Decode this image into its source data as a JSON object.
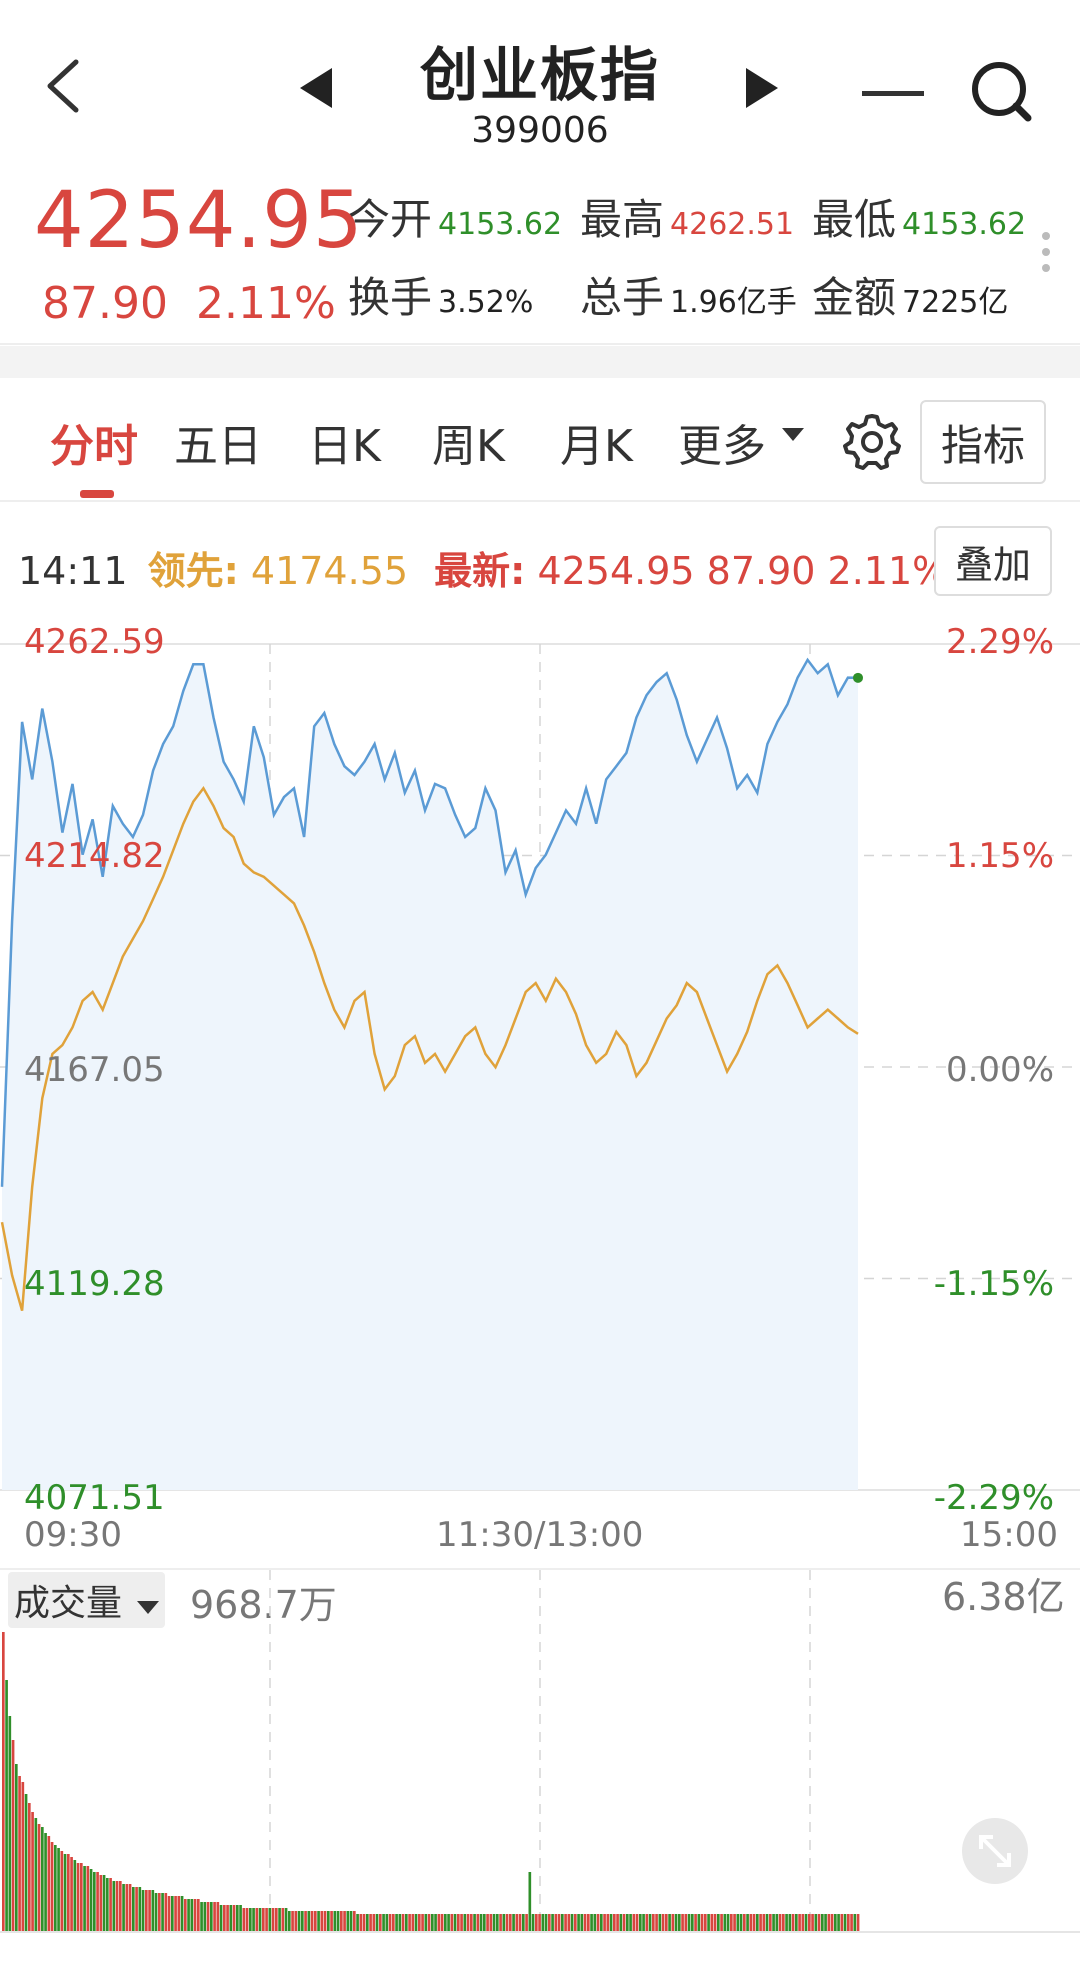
{
  "header": {
    "title": "创业板指",
    "code": "399006",
    "back_icon": "chevron-left-icon",
    "prev_icon": "caret-left-icon",
    "next_icon": "caret-right-icon",
    "menu_icon": "minus-icon",
    "search_icon": "search-icon"
  },
  "quote": {
    "price": "4254.95",
    "change": "87.90",
    "change_pct": "2.11%",
    "stats": [
      {
        "label": "今开",
        "value": "4153.62",
        "color": "#2f8f2a"
      },
      {
        "label": "最高",
        "value": "4262.51",
        "color": "#d8463f"
      },
      {
        "label": "最低",
        "value": "4153.62",
        "color": "#2f8f2a"
      },
      {
        "label": "换手",
        "value": "3.52%",
        "color": "#222222"
      },
      {
        "label": "总手",
        "value": "1.96亿手",
        "color": "#222222"
      },
      {
        "label": "金额",
        "value": "7225亿",
        "color": "#222222"
      }
    ]
  },
  "tabs": {
    "items": [
      "分时",
      "五日",
      "日K",
      "周K",
      "月K",
      "更多"
    ],
    "active_index": 0,
    "settings_icon": "gear-icon",
    "indicator_button": "指标"
  },
  "info_bar": {
    "time": "14:11",
    "leader_label": "领先:",
    "leader_value": "4174.55",
    "latest_label": "最新:",
    "latest_value": "4254.95 87.90 2.11%",
    "overlay_button": "叠加"
  },
  "chart_data": {
    "type": "line",
    "y_labels_left": [
      "4262.59",
      "4214.82",
      "4167.05",
      "4119.28",
      "4071.51"
    ],
    "y_labels_right": [
      "2.29%",
      "1.15%",
      "0.00%",
      "-1.15%",
      "-2.29%"
    ],
    "x_labels": [
      "09:30",
      "11:30/13:00",
      "15:00"
    ],
    "ylim": [
      4071.51,
      4262.59
    ],
    "baseline": 4167.05,
    "colors": {
      "price": "#5b9bd5",
      "leader": "#e0a23a",
      "up": "#d8463f",
      "down": "#2f8f2a"
    },
    "series": [
      {
        "values": [
          4140,
          4200,
          4245,
          4232,
          4248,
          4236,
          4220,
          4231,
          4215,
          4223,
          4210,
          4226,
          4222,
          4219,
          4224,
          4234,
          4240,
          4244,
          4252,
          4258,
          4258,
          4246,
          4236,
          4232,
          4227,
          4244,
          4237,
          4224,
          4228,
          4230,
          4219,
          4244,
          4247,
          4240,
          4235,
          4233,
          4236,
          4240,
          4232,
          4238,
          4229,
          4234,
          4225,
          4231,
          4230,
          4224,
          4219,
          4221,
          4230,
          4225,
          4211,
          4216,
          4206,
          4212,
          4215,
          4220,
          4225,
          4222,
          4230,
          4222,
          4232,
          4235,
          4238,
          4246,
          4251,
          4254,
          4256,
          4250,
          4242,
          4236,
          4241,
          4246,
          4239,
          4230,
          4233,
          4229,
          4240,
          4245,
          4249,
          4255,
          4259,
          4256,
          4258,
          4251,
          4255,
          4254.95
        ]
      },
      {
        "values": [
          4132,
          4120,
          4112,
          4140,
          4160,
          4170,
          4172,
          4176,
          4182,
          4184,
          4180,
          4186,
          4192,
          4196,
          4200,
          4205,
          4210,
          4216,
          4222,
          4227,
          4230,
          4226,
          4221,
          4219,
          4213,
          4211,
          4210,
          4208,
          4206,
          4204,
          4199,
          4193,
          4186,
          4180,
          4176,
          4182,
          4184,
          4170,
          4162,
          4165,
          4172,
          4174,
          4168,
          4170,
          4166,
          4170,
          4174,
          4176,
          4170,
          4167,
          4172,
          4178,
          4184,
          4186,
          4182,
          4187,
          4184,
          4179,
          4172,
          4168,
          4170,
          4175,
          4172,
          4165,
          4168,
          4173,
          4178,
          4181,
          4186,
          4184,
          4178,
          4172,
          4166,
          4170,
          4175,
          4182,
          4188,
          4190,
          4186,
          4181,
          4176,
          4178,
          4180,
          4178,
          4176,
          4174.55
        ]
      }
    ]
  },
  "volume": {
    "label": "成交量",
    "value": "968.7万",
    "max_label": "6.38亿",
    "expand_icon": "expand-icon",
    "bars": [
      100,
      84,
      72,
      64,
      56,
      52,
      50,
      46,
      43,
      40,
      38,
      36,
      35,
      33,
      32,
      30,
      29,
      28,
      27,
      26,
      26,
      25,
      24,
      23,
      23,
      22,
      22,
      21,
      20,
      20,
      19,
      19,
      18,
      18,
      17,
      17,
      17,
      16,
      16,
      16,
      15,
      15,
      15,
      14,
      14,
      14,
      14,
      13,
      13,
      13,
      13,
      12,
      12,
      12,
      12,
      12,
      11,
      11,
      11,
      11,
      11,
      10,
      10,
      10,
      10,
      10,
      10,
      9,
      9,
      9,
      9,
      9,
      9,
      9,
      8,
      8,
      8,
      8,
      8,
      8,
      8,
      8,
      8,
      8,
      8,
      8,
      8,
      8,
      7,
      7,
      7,
      7,
      7,
      7,
      7,
      7,
      7,
      7,
      7,
      7,
      7,
      7,
      7,
      7,
      7,
      7,
      7,
      7,
      7,
      6,
      6,
      6,
      6,
      6,
      6,
      6,
      6,
      6,
      6,
      6,
      6,
      6,
      6,
      6,
      6,
      6,
      6,
      6,
      6,
      6,
      6,
      6,
      6,
      6,
      6,
      6,
      6,
      6,
      6,
      6,
      6,
      6,
      6,
      6,
      6,
      6,
      6,
      6,
      6,
      6,
      6,
      6,
      6,
      6,
      6,
      6,
      6,
      6,
      6,
      6,
      6,
      6,
      20,
      6,
      6,
      6,
      6,
      6,
      6,
      6,
      6,
      6,
      6,
      6,
      6,
      6,
      6,
      6,
      6,
      6,
      6,
      6,
      6,
      6,
      6,
      6,
      6,
      6,
      6,
      6,
      6,
      6,
      6,
      6,
      6,
      6,
      6,
      6,
      6,
      6,
      6,
      6,
      6,
      6,
      6,
      6,
      6,
      6,
      6,
      6,
      6,
      6,
      6,
      6,
      6,
      6,
      6,
      6,
      6,
      6,
      6,
      6,
      6,
      6,
      6,
      6,
      6,
      6,
      6,
      6,
      6,
      6,
      6,
      6,
      6,
      6,
      6,
      6,
      6,
      6,
      6,
      6,
      6,
      6,
      6,
      6,
      6,
      6,
      6,
      6,
      6,
      6,
      6,
      6,
      6,
      6,
      6,
      6,
      6,
      6,
      6,
      6,
      6,
      6
    ]
  }
}
